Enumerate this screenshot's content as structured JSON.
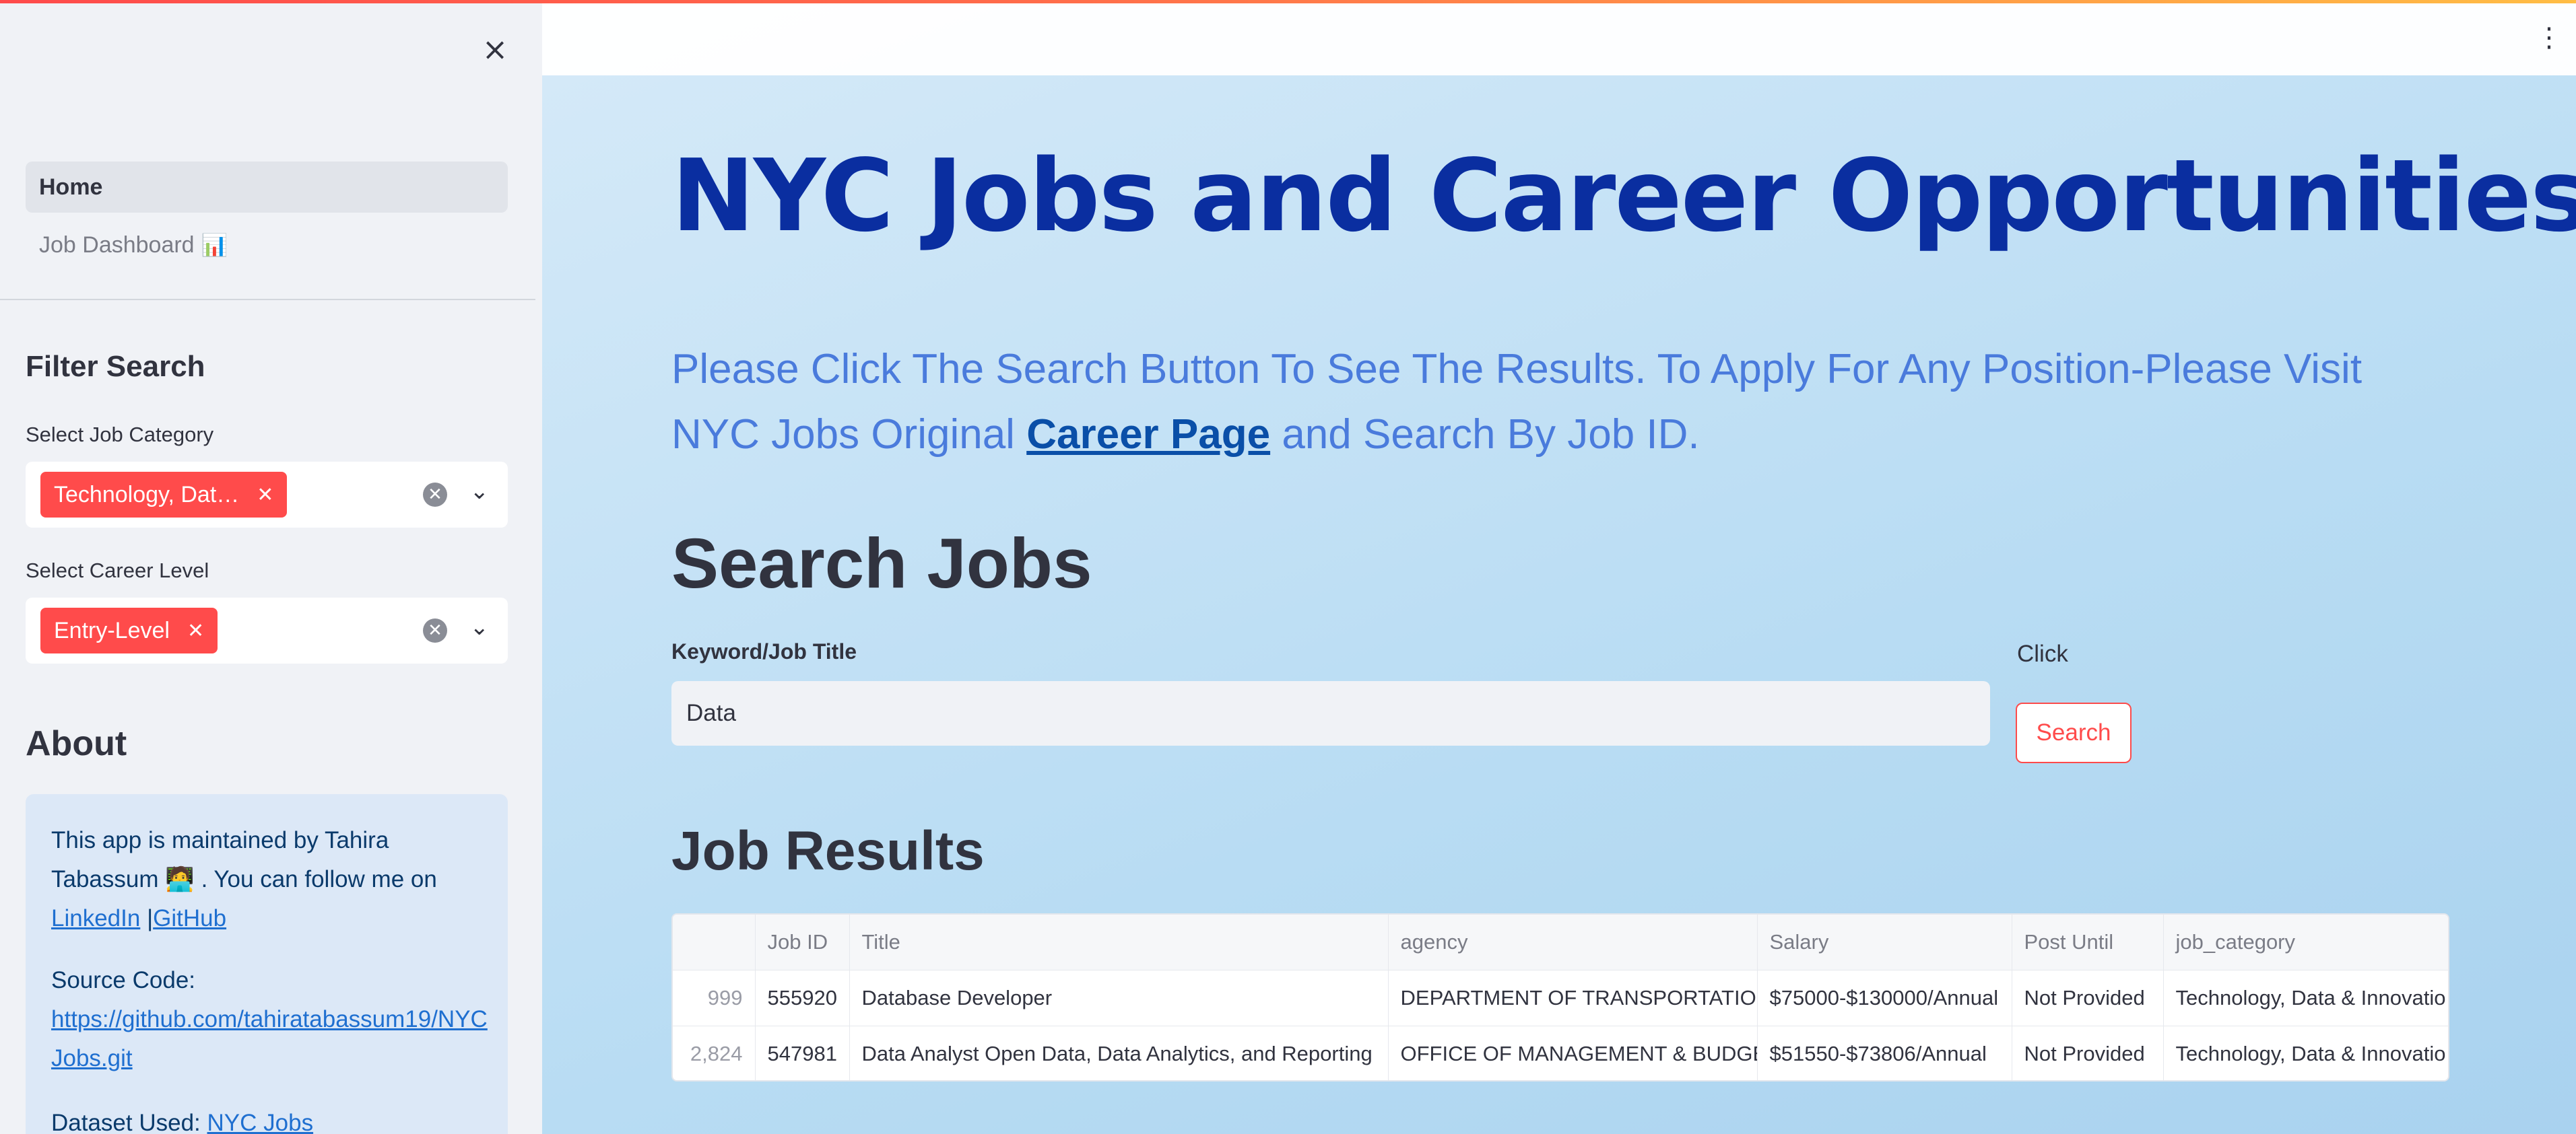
{
  "sidebar": {
    "close_icon": "×",
    "nav": [
      {
        "label": "Home",
        "active": true
      },
      {
        "label": "Job Dashboard",
        "emoji": "📊"
      }
    ],
    "filter_heading": "Filter Search",
    "job_category": {
      "label": "Select Job Category",
      "tag": "Technology, Dat…"
    },
    "career_level": {
      "label": "Select Career Level",
      "tag": "Entry-Level"
    },
    "about_heading": "About",
    "about": {
      "line1": "This app is maintained by Tahira Tabassum",
      "emoji": "🧑‍💻",
      "line1_tail": ". You can follow me on",
      "linkedin": "LinkedIn",
      "separator": "|",
      "github": "GitHub",
      "source_label": "Source Code:",
      "source_link": "https://github.com/tahiratabassum19/NYCJobs.git",
      "dataset_label": "Dataset Used:",
      "dataset_link": "NYC Jobs"
    }
  },
  "main": {
    "title": "NYC Jobs and Career Opportunities",
    "intro": {
      "part1": "Please Click The Search Button To See The Results. To Apply For Any Position-Please Visit NYC Jobs Original",
      "link": "Career Page",
      "part2": "and Search By Job ID."
    },
    "search_heading": "Search Jobs",
    "keyword_label": "Keyword/Job Title",
    "keyword_value": "Data",
    "click_label": "Click",
    "search_button": "Search",
    "results_heading": "Job Results",
    "table": {
      "columns": [
        "",
        "Job ID",
        "Title",
        "agency",
        "Salary",
        "Post Until",
        "job_category"
      ],
      "rows": [
        [
          "999",
          "555920",
          "Database Developer",
          "DEPARTMENT OF TRANSPORTATION",
          "$75000-$130000/Annual",
          "Not Provided",
          "Technology, Data & Innovatio"
        ],
        [
          "2,824",
          "547981",
          "Data Analyst Open Data, Data Analytics, and Reporting",
          "OFFICE OF MANAGEMENT & BUDGET",
          "$51550-$73806/Annual",
          "Not Provided",
          "Technology, Data & Innovatio"
        ]
      ]
    }
  },
  "colors": {
    "accent": "#ff4b4b",
    "title": "#0a2ea0",
    "intro": "#4a7bdc",
    "sidebar_bg": "#f0f2f6"
  },
  "icons": {
    "close": "close-icon",
    "menu": "kebab-menu-icon",
    "clear": "clear-icon",
    "chevron": "chevron-down-icon"
  }
}
